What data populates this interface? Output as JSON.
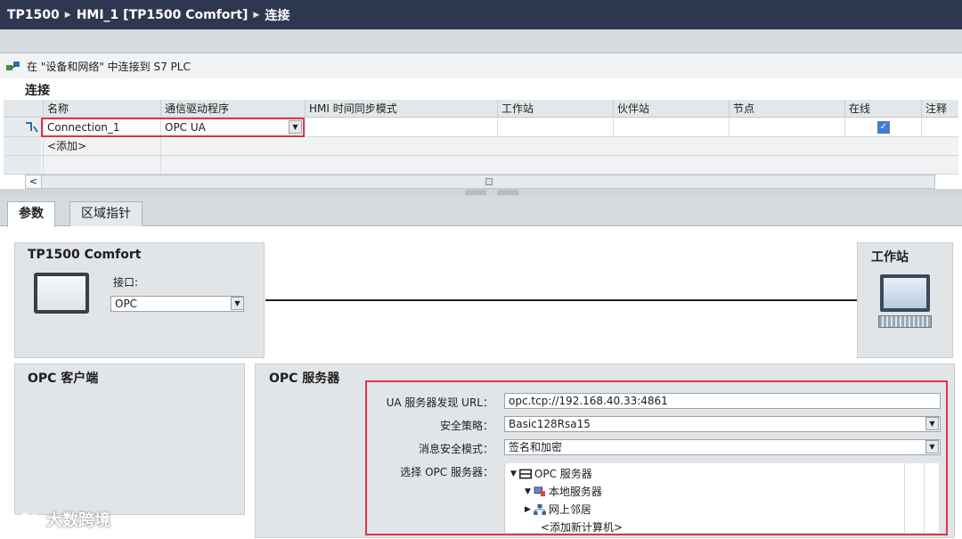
{
  "breadcrumb": {
    "project": "TP1500",
    "device": "HMI_1 [TP1500 Comfort]",
    "page": "连接"
  },
  "hint": {
    "text": "在 \"设备和网络\" 中连接到 S7 PLC"
  },
  "connections": {
    "heading": "连接",
    "columns": [
      "名称",
      "通信驱动程序",
      "HMI 时间同步模式",
      "工作站",
      "伙伴站",
      "节点",
      "在线",
      "注释"
    ],
    "rows": [
      {
        "name": "Connection_1",
        "driver": "OPC UA",
        "online": true
      }
    ],
    "add_label": "<添加>"
  },
  "tabs": [
    {
      "label": "参数",
      "active": true
    },
    {
      "label": "区域指针",
      "active": false
    }
  ],
  "device": {
    "title": "TP1500 Comfort",
    "interface_label": "接口:",
    "interface_value": "OPC"
  },
  "workstation": {
    "title": "工作站"
  },
  "opc_client": {
    "title": "OPC 客户端"
  },
  "opc_server": {
    "title": "OPC 服务器",
    "url_label": "UA 服务器发现 URL：",
    "url_value": "opc.tcp://192.168.40.33:4861",
    "policy_label": "安全策略：",
    "policy_value": "Basic128Rsa15",
    "mode_label": "消息安全模式：",
    "mode_value": "签名和加密",
    "select_label": "选择 OPC 服务器：",
    "tree": {
      "root": "OPC 服务器",
      "local": "本地服务器",
      "network": "网上邻居",
      "add": "<添加新计算机>"
    }
  },
  "watermark": {
    "text": "大数跨境"
  },
  "colors": {
    "titlebar": "#2d3850",
    "highlight": "#e0344a",
    "checkbox": "#3b7fd8"
  }
}
